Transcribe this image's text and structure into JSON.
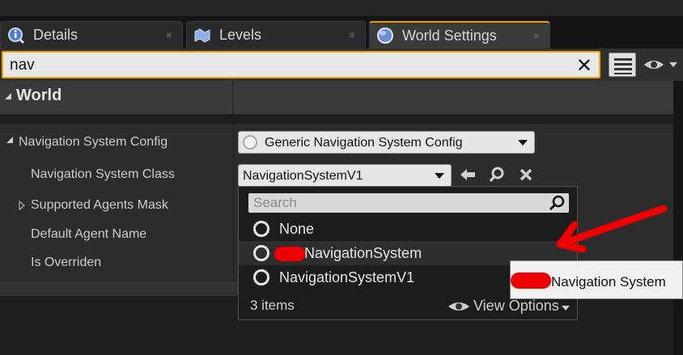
{
  "tabs": [
    {
      "label": "Details",
      "icon": "info-icon"
    },
    {
      "label": "Levels",
      "icon": "levels-icon"
    },
    {
      "label": "World Settings",
      "icon": "globe-icon",
      "active": true
    }
  ],
  "search": {
    "value": "nav"
  },
  "category": {
    "label": "World"
  },
  "properties": {
    "nav_system_config": {
      "label": "Navigation System Config",
      "value": "Generic Navigation System Config"
    },
    "nav_system_class": {
      "label": "Navigation System Class",
      "value": "NavigationSystemV1"
    },
    "supported_agents_mask": {
      "label": "Supported Agents Mask"
    },
    "default_agent_name": {
      "label": "Default Agent Name"
    },
    "is_overriden": {
      "label": "Is Overriden"
    }
  },
  "dropdown": {
    "search_placeholder": "Search",
    "items": [
      "None",
      "NavigationSystem",
      "NavigationSystemV1"
    ],
    "count_label": "3 items",
    "view_options_label": "View Options"
  },
  "tooltip": {
    "text": "Navigation System"
  },
  "colors": {
    "accent": "#f0a800",
    "annotation": "#ee0000"
  }
}
